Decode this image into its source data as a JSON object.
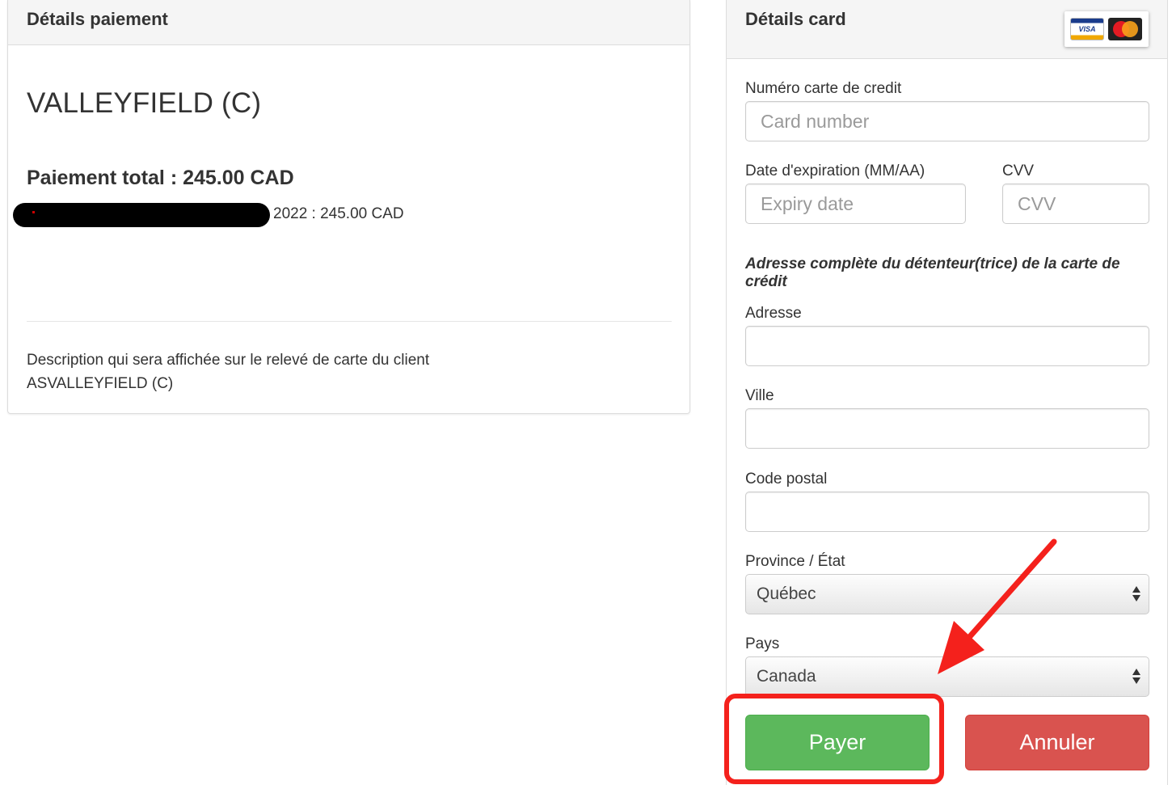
{
  "payment_details": {
    "title": "Détails paiement",
    "organization": "VALLEYFIELD (C)",
    "total": "Paiement total : 245.00 CAD",
    "line_item_suffix": "2022 : 245.00 CAD",
    "description_label": "Description qui sera affichée sur le relevé de carte du client",
    "description_value": "ASVALLEYFIELD (C)"
  },
  "card_details": {
    "title": "Détails card",
    "card_logos": [
      "VISA",
      "MasterCard"
    ],
    "card_number_label": "Numéro carte de credit",
    "card_number_placeholder": "Card number",
    "expiry_label": "Date d'expiration (MM/AA)",
    "expiry_placeholder": "Expiry date",
    "cvv_label": "CVV",
    "cvv_placeholder": "CVV",
    "address_heading": "Adresse complète du détenteur(trice) de la carte de crédit",
    "address_label": "Adresse",
    "address_value": "",
    "city_label": "Ville",
    "city_value": "",
    "postal_label": "Code postal",
    "postal_value": "",
    "province_label": "Province / État",
    "province_selected": "Québec",
    "country_label": "Pays",
    "country_selected": "Canada"
  },
  "buttons": {
    "pay_label": "Payer",
    "cancel_label": "Annuler"
  },
  "colors": {
    "pay_green": "#5cb85c",
    "cancel_red": "#d9534f",
    "annotation_red": "#f4211c"
  },
  "icons": [
    "visa-logo-icon",
    "mastercard-logo-icon",
    "select-arrows-icon",
    "annotation-arrow-icon"
  ]
}
